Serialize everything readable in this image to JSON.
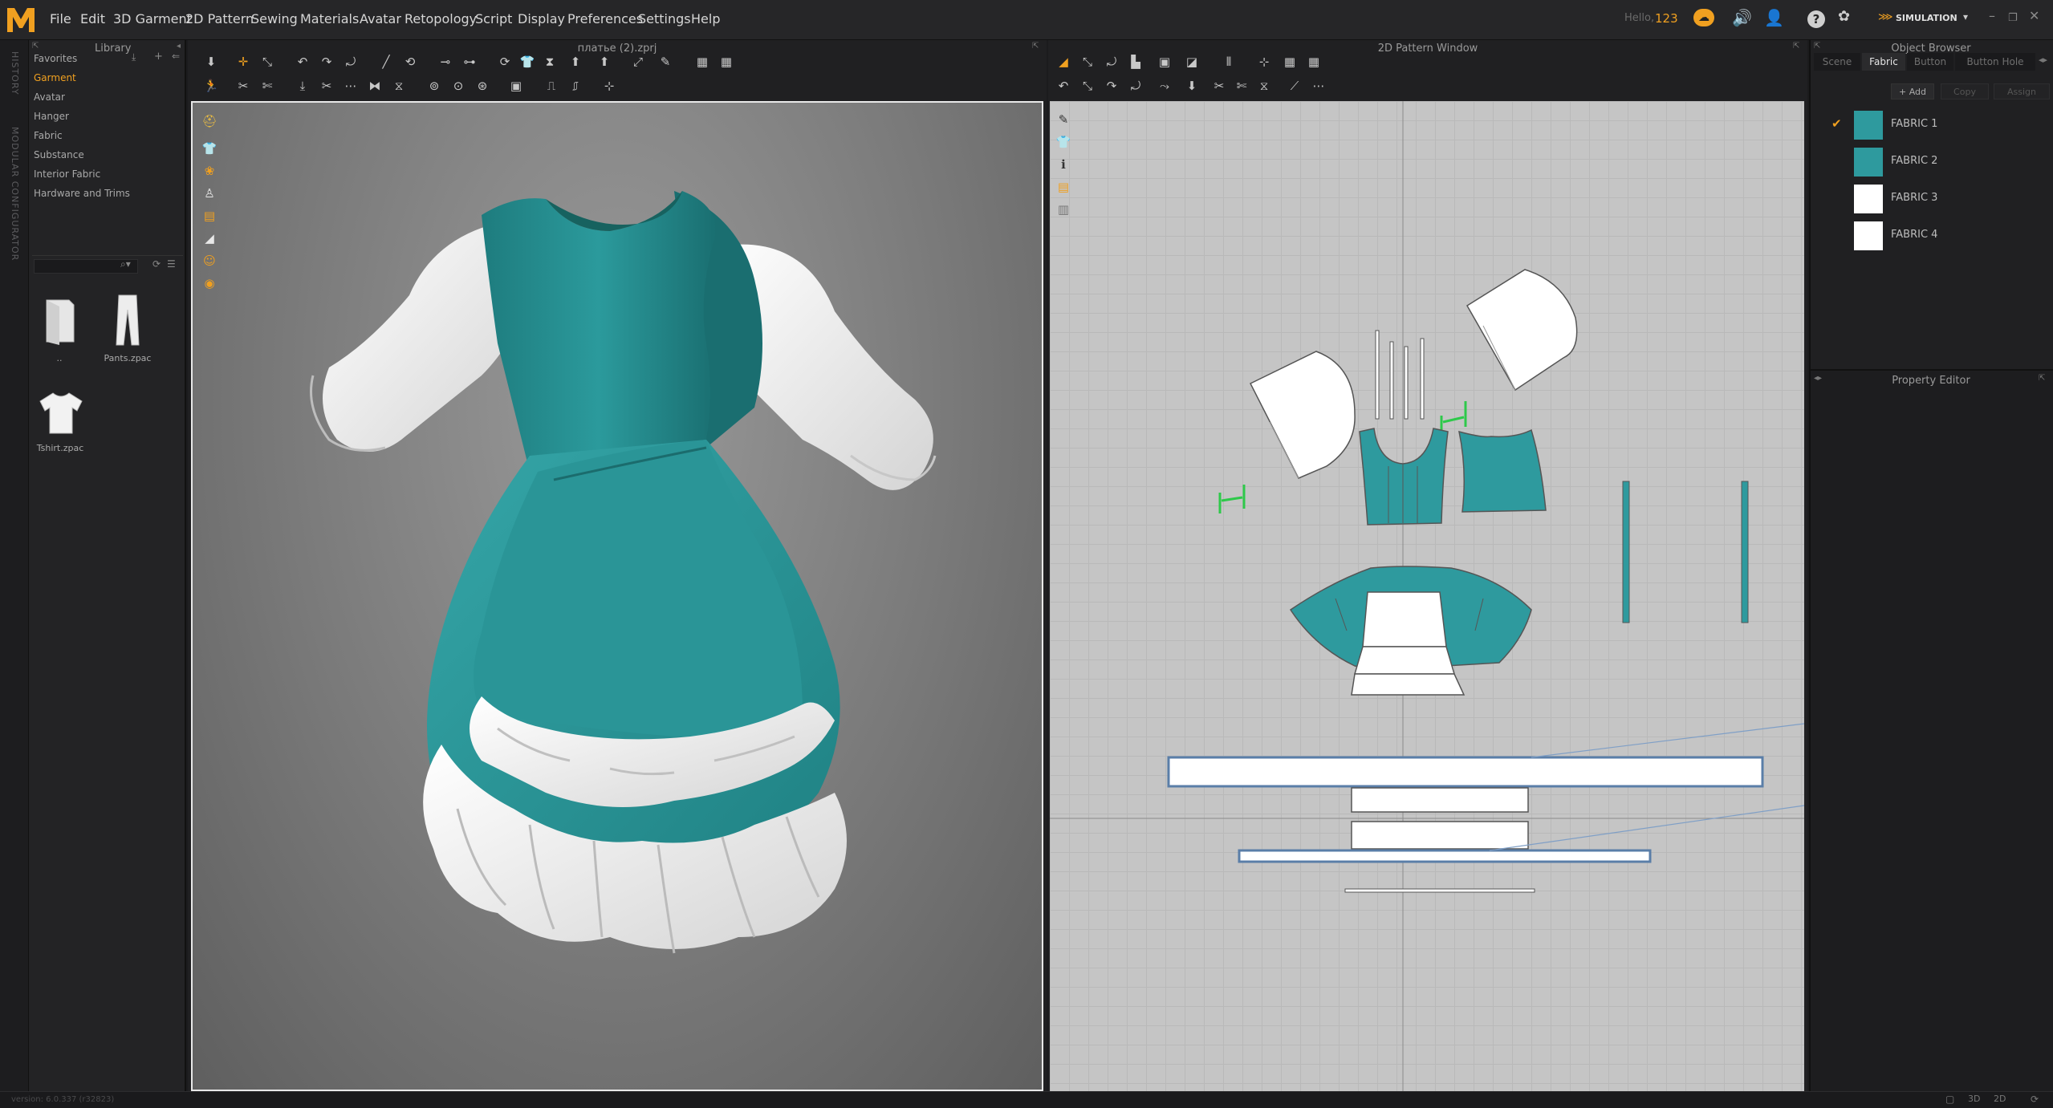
{
  "app": {
    "logo_letter": "M",
    "menu": [
      "File",
      "Edit",
      "3D Garment",
      "2D Pattern",
      "Sewing",
      "Materials",
      "Avatar",
      "Retopology",
      "Script",
      "Display",
      "Preferences",
      "Settings",
      "Help"
    ],
    "greeting": "Hello,",
    "user": "123",
    "mode": "SIMULATION",
    "accent": "#f0a020"
  },
  "sidestrip": {
    "history": "HISTORY",
    "modular": "MODULAR CONFIGURATOR"
  },
  "library": {
    "title": "Library",
    "items": [
      "Favorites",
      "Garment",
      "Avatar",
      "Hanger",
      "Fabric",
      "Substance",
      "Interior Fabric",
      "Hardware and Trims"
    ],
    "active": "Garment",
    "files": [
      {
        "name": "..",
        "icon": "folder-icon"
      },
      {
        "name": "Pants.zpac",
        "icon": "pants-icon"
      },
      {
        "name": "Tshirt.zpac",
        "icon": "tshirt-icon"
      }
    ]
  },
  "view3d": {
    "title": "платье (2).zprj"
  },
  "view2d": {
    "title": "2D Pattern Window"
  },
  "object_browser": {
    "title": "Object Browser",
    "tabs": [
      "Scene",
      "Fabric",
      "Button",
      "Button Hole"
    ],
    "active_tab": "Fabric",
    "buttons": [
      "+ Add",
      "Copy",
      "Assign"
    ],
    "fabrics": [
      {
        "name": "FABRIC 1",
        "color": "#2e9a9e",
        "checked": true
      },
      {
        "name": "FABRIC 2",
        "color": "#2e9a9e",
        "checked": false
      },
      {
        "name": "FABRIC 3",
        "color": "#ffffff",
        "checked": false
      },
      {
        "name": "FABRIC 4",
        "color": "#ffffff",
        "checked": false
      }
    ]
  },
  "property_editor": {
    "title": "Property Editor"
  },
  "status": {
    "version": "version: 6.0.337 (r32823)"
  },
  "colors": {
    "garment_teal": "#2b9a9c",
    "garment_white": "#f2f2f2"
  }
}
